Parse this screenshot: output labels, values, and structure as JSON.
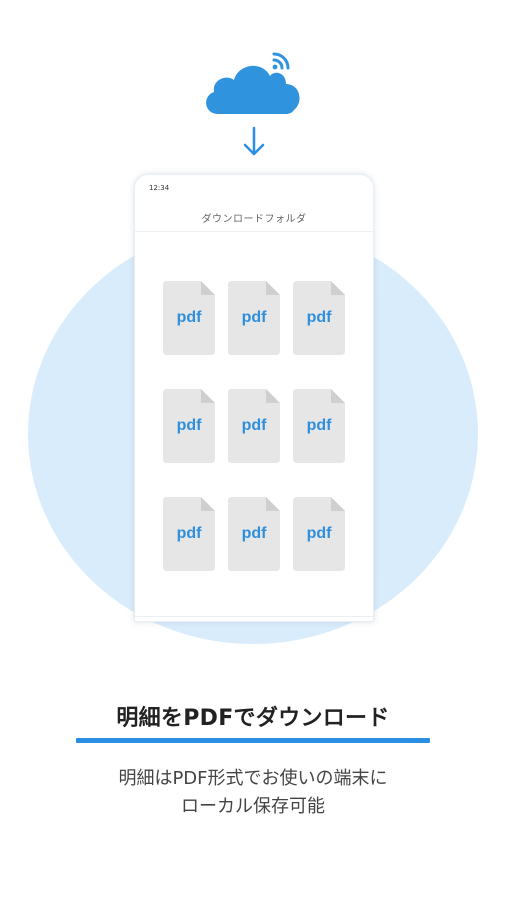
{
  "colors": {
    "accent": "#2a8ee2",
    "cloud": "#2f93dd",
    "circle": "#d9ecfb",
    "file_bg": "#e6e6e6",
    "file_fold": "#cfcfcf",
    "file_text": "#2f8fdc"
  },
  "icons": {
    "cloud": "cloud-wifi-icon",
    "arrow": "arrow-down-icon",
    "file": "pdf-file-icon"
  },
  "phone": {
    "status_time": "12:34",
    "title": "ダウンロードフォルダ",
    "files": [
      "pdf",
      "pdf",
      "pdf",
      "pdf",
      "pdf",
      "pdf",
      "pdf",
      "pdf",
      "pdf"
    ]
  },
  "headline": "明細をPDFでダウンロード",
  "description": {
    "line1": "明細はPDF形式でお使いの端末に",
    "line2": "ローカル保存可能"
  }
}
